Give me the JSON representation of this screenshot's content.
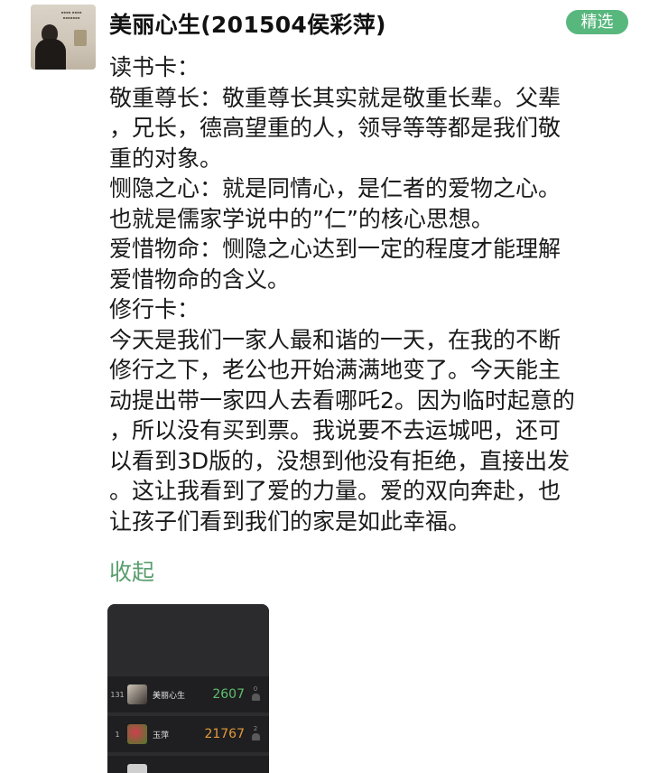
{
  "post": {
    "author": "美丽心生(201504侯彩萍)",
    "badge": "精选",
    "lines": [
      "读书卡：",
      "敬重尊长：敬重尊长其实就是敬重长辈。父辈",
      "，兄长，德高望重的人，领导等等都是我们敬",
      "重的对象。",
      "恻隐之心：就是同情心，是仁者的爱物之心。",
      "也就是儒家学说中的”仁”的核心思想。",
      "爱惜物命：恻隐之心达到一定的程度才能理解",
      "爱惜物命的含义。",
      "修行卡：",
      "今天是我们一家人最和谐的一天，在我的不断",
      "修行之下，老公也开始满满地变了。今天能主",
      "动提出带一家四人去看哪吒2。因为临时起意的",
      "，所以没有买到票。我说要不去运城吧，还可",
      "以看到3D版的，没想到他没有拒绝，直接出发",
      "。这让我看到了爱的力量。爱的双向奔赴，也",
      "让孩子们看到我们的家是如此幸福。"
    ],
    "collapse_label": "收起"
  },
  "ranking_card": {
    "rows": [
      {
        "rank": "131",
        "name": "美丽心生",
        "steps": "2607",
        "likes": "0",
        "steps_color": "#5fbf6e"
      },
      {
        "rank": "1",
        "name": "玉萍",
        "steps": "21767",
        "likes": "2",
        "steps_color": "#e39a3a"
      }
    ]
  },
  "colors": {
    "accent_green": "#58b77d",
    "link_green": "#5a9e6f"
  }
}
